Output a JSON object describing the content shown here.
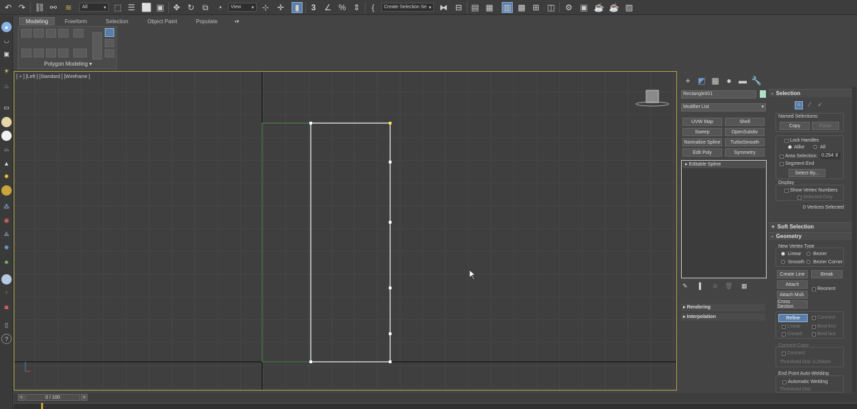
{
  "toolbar": {
    "filter_dropdown": "All",
    "view_dropdown": "View",
    "selection_set_dropdown": "Create Selection Se",
    "snap_label": "3"
  },
  "ribbon": {
    "tabs": [
      "Modeling",
      "Freeform",
      "Selection",
      "Object Paint",
      "Populate"
    ],
    "panel_label": "Polygon Modeling"
  },
  "viewport": {
    "label": "[ + ] [Left ] [Standard ] [Wireframe ]"
  },
  "command_panel": {
    "object_name": "Rectangle001",
    "object_color": "#aee0c8",
    "modifier_list": "Modifier List",
    "modifier_buttons": [
      "UVW Map",
      "Shell",
      "Sweep",
      "OpenSubdiv",
      "Normalize Spline",
      "TurboSmooth",
      "Edit Poly",
      "Symmetry"
    ],
    "stack_item": "Editable Spline",
    "rollouts": [
      "Rendering",
      "Interpolation"
    ]
  },
  "selection_rollout": {
    "title": "Selection",
    "named_selections": "Named Selections:",
    "copy": "Copy",
    "paste": "Paste",
    "lock_handles": "Lock Handles",
    "alike": "Alike",
    "all": "All",
    "area_selection": "Area Selection:",
    "area_value": "0.254",
    "segment_end": "Segment End",
    "select_by": "Select By...",
    "display": "Display",
    "show_vertex_numbers": "Show Vertex Numbers",
    "selected_only": "Selected Only",
    "status": "0 Vertices Selected"
  },
  "soft_selection": {
    "title": "Soft Selection"
  },
  "geometry": {
    "title": "Geometry",
    "new_vertex_type": "New Vertex Type",
    "linear": "Linear",
    "bezier": "Bezier",
    "smooth": "Smooth",
    "bezier_corner": "Bezier Corner",
    "create_line": "Create Line",
    "break": "Break",
    "attach": "Attach",
    "reorient": "Reorient",
    "attach_mult": "Attach Mult.",
    "cross_section": "Cross Section",
    "refine": "Refine",
    "connect": "Connect",
    "linear2": "Linear",
    "bind_first": "Bind first",
    "closed": "Closed",
    "bind_last": "Bind last",
    "connect_copy": "Connect Copy",
    "connect2": "Connect",
    "threshold_dist": "Threshold Dist",
    "threshold_value": "0.254cm",
    "end_point_auto_welding": "End Point Auto-Welding",
    "automatic_welding": "Automatic Welding",
    "threshold_dist2": "Threshold Dist"
  },
  "timeline": {
    "frame": "0 / 100",
    "prev": "<",
    "next": ">"
  },
  "colors": {
    "viewport_border": "#b3a54a",
    "spline": "#ffffff",
    "spline_green": "#4d8a4d",
    "vertex_selected": "#ffe24a",
    "active_button": "#5a7ea8"
  },
  "icons": {
    "undo": "undo-icon",
    "redo": "redo-icon",
    "link": "link-icon",
    "unlink": "unlink-icon",
    "bind": "bind-space-warp-icon",
    "select": "select-object-icon",
    "move": "move-icon",
    "rotate": "rotate-icon",
    "scale": "scale-icon"
  }
}
